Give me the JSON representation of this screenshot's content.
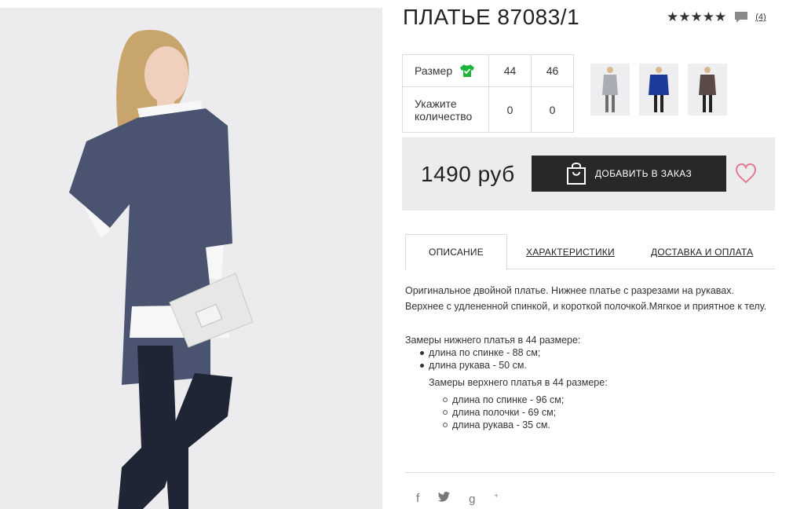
{
  "product": {
    "title": "ПЛАТЬЕ 87083/1",
    "rating_stars": "★★★★★",
    "review_count": "(4)",
    "price": "1490 руб"
  },
  "size_table": {
    "size_label": "Размер",
    "qty_label": "Укажите количество",
    "sizes": [
      "44",
      "46"
    ],
    "quantities": [
      "0",
      "0"
    ]
  },
  "buy_box": {
    "add_button_label": "ДОБАВИТЬ В ЗАКАЗ"
  },
  "tabs": [
    {
      "label": "ОПИСАНИЕ"
    },
    {
      "label": "ХАРАКТЕРИСТИКИ"
    },
    {
      "label": "ДОСТАВКА И ОПЛАТА"
    }
  ],
  "description": {
    "intro": "Оригинальное двойной платье. Нижнее платье с разрезами на рукавах. Верхнее с удлененной спинкой, и короткой полочкой.Мягкое и приятное к телу.",
    "lower_title": "Замеры нижнего платья в 44 размере:",
    "lower_items": [
      "длина по спинке - 88 см;",
      "длина рукава - 50 см."
    ],
    "upper_title": "Замеры верхнего платья в 44 размере:",
    "upper_items": [
      "длина по спинке - 96 см;",
      "длина полочки - 69 см;",
      "длина рукава - 35 см."
    ]
  },
  "social": {
    "facebook": "f",
    "twitter": "🐦",
    "gplus": "g"
  },
  "colors": {
    "dress_navy": "#4a5470",
    "button_dark": "#282828",
    "heart_pink": "#e07a94",
    "check_green": "#1fb33d"
  }
}
